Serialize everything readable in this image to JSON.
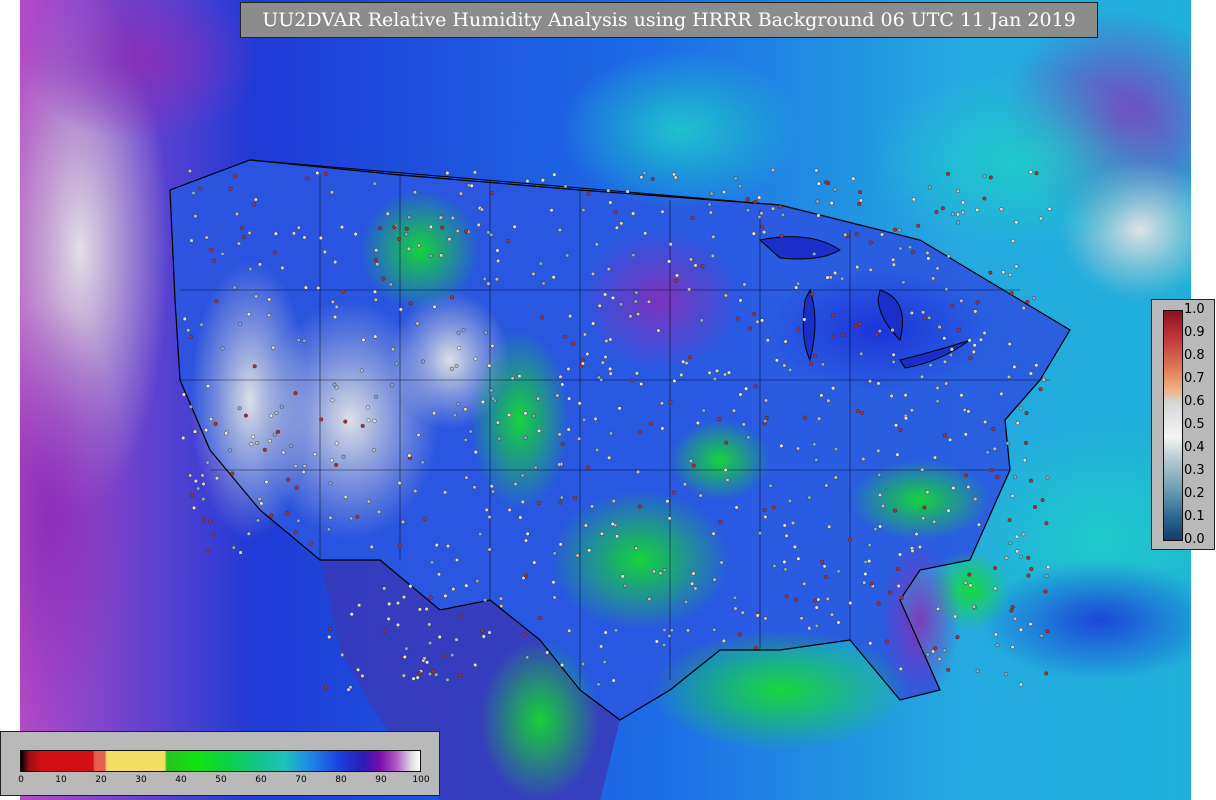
{
  "map": {
    "title": "UU2DVAR Relative Humidity Analysis using HRRR Background 06 UTC 11 Jan 2019",
    "colors": {
      "ocean_west": "#b44bc6",
      "ocean_central": "#1f3bd6",
      "ocean_east": "#25a9e0",
      "land_dry": "#cfcfcf",
      "land_moist_green": "#14d626",
      "station_dot": "#d9d9d9"
    }
  },
  "colorbar_values": {
    "orientation": "vertical",
    "ticks": [
      "1.0",
      "0.9",
      "0.8",
      "0.7",
      "0.6",
      "0.5",
      "0.4",
      "0.3",
      "0.2",
      "0.1",
      "0.0"
    ]
  },
  "colorbar_rh": {
    "orientation": "horizontal",
    "ticks": [
      "0",
      "10",
      "20",
      "30",
      "40",
      "50",
      "60",
      "70",
      "80",
      "90",
      "100"
    ]
  }
}
